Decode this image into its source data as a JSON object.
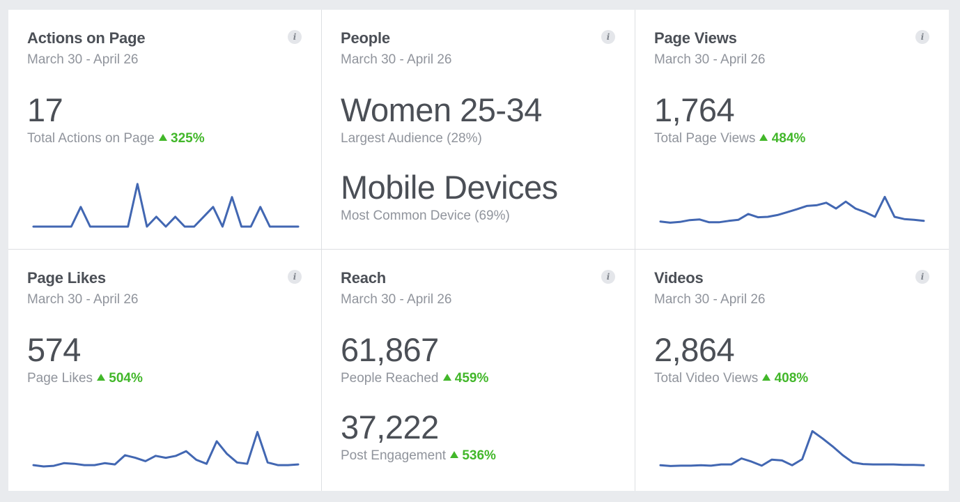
{
  "colors": {
    "accent": "#4267b2",
    "positive": "#42b72a",
    "title": "#4b4f56",
    "muted": "#90949c"
  },
  "cards": {
    "actions": {
      "title": "Actions on Page",
      "date": "March 30 - April 26",
      "value": "17",
      "label": "Total Actions on Page",
      "delta": "325%",
      "spark": [
        0,
        0,
        0,
        0,
        0,
        3,
        0,
        0,
        0,
        0,
        0,
        6.5,
        0,
        1.5,
        0,
        1.5,
        0,
        0,
        1.5,
        3,
        0,
        4.5,
        0,
        0,
        3,
        0,
        0,
        0,
        0
      ]
    },
    "people": {
      "title": "People",
      "date": "March 30 - April 26",
      "audience_value": "Women 25-34",
      "audience_label": "Largest Audience (28%)",
      "device_value": "Mobile Devices",
      "device_label": "Most Common Device (69%)"
    },
    "page_views": {
      "title": "Page Views",
      "date": "March 30 - April 26",
      "value": "1,764",
      "label": "Total Page Views",
      "delta": "484%",
      "spark": [
        1,
        0.7,
        0.9,
        1.4,
        1.6,
        0.8,
        0.8,
        1.2,
        1.5,
        3.1,
        2.2,
        2.3,
        2.8,
        3.6,
        4.4,
        5.3,
        5.5,
        6.2,
        4.6,
        6.5,
        4.6,
        3.6,
        2.3,
        7.8,
        2.3,
        1.7,
        1.5,
        1.2
      ]
    },
    "page_likes": {
      "title": "Page Likes",
      "date": "March 30 - April 26",
      "value": "574",
      "label": "Page Likes",
      "delta": "504%",
      "spark": [
        0.2,
        0,
        0.1,
        0.5,
        0.4,
        0.2,
        0.2,
        0.5,
        0.3,
        1.7,
        1.3,
        0.8,
        1.6,
        1.3,
        1.6,
        2.3,
        1,
        0.4,
        3.8,
        1.9,
        0.6,
        0.4,
        5.2,
        0.6,
        0.2,
        0.2,
        0.3
      ]
    },
    "reach": {
      "title": "Reach",
      "date": "March 30 - April 26",
      "reached_value": "61,867",
      "reached_label": "People Reached",
      "reached_delta": "459%",
      "engagement_value": "37,222",
      "engagement_label": "Post Engagement",
      "engagement_delta": "536%"
    },
    "videos": {
      "title": "Videos",
      "date": "March 30 - April 26",
      "value": "2,864",
      "label": "Total Video Views",
      "delta": "408%",
      "spark": [
        0.3,
        0.1,
        0.2,
        0.2,
        0.3,
        0.2,
        0.5,
        0.5,
        2,
        1.2,
        0.2,
        1.7,
        1.5,
        0.3,
        1.8,
        8.8,
        7,
        5,
        2.8,
        1,
        0.6,
        0.5,
        0.5,
        0.5,
        0.4,
        0.4,
        0.3
      ]
    }
  }
}
